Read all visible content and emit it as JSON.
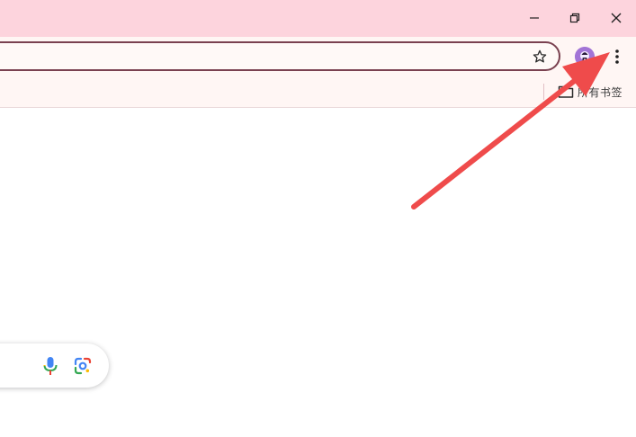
{
  "window": {
    "controls": {
      "minimize_icon": "minimize-icon",
      "restore_icon": "restore-icon",
      "close_icon": "close-icon"
    },
    "titlebar_color": "#fdd4dd"
  },
  "toolbar": {
    "address_value": "",
    "bookmark_star_icon": "star-icon",
    "profile_avatar_icon": "profile-avatar-icon",
    "menu_icon": "vertical-dots-icon",
    "accent_color": "#7a4150"
  },
  "bookmarks_bar": {
    "all_bookmarks_icon": "folder-icon",
    "all_bookmarks_label": "所有书签"
  },
  "content": {
    "search_box": {
      "voice_icon": "microphone-icon",
      "lens_icon": "google-lens-icon"
    }
  },
  "annotation": {
    "arrow_color": "#ef4b4b",
    "points_to": "menu-icon"
  }
}
